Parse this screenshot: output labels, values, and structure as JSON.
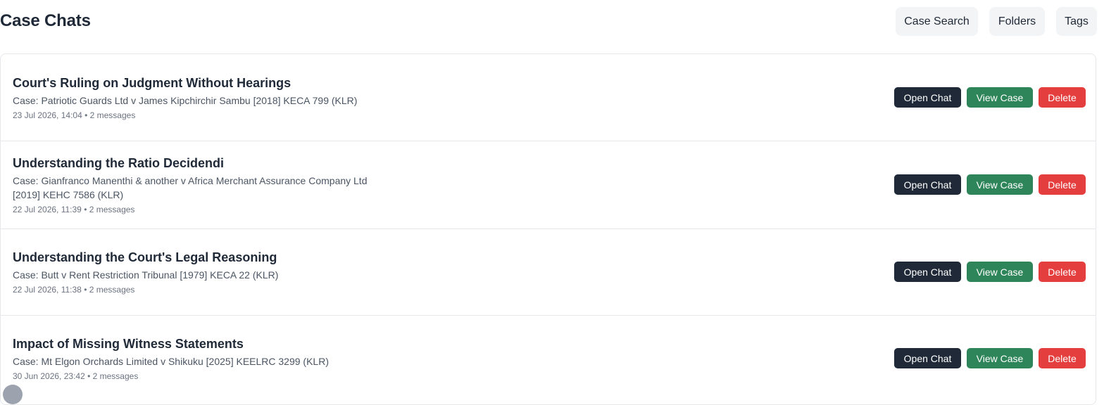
{
  "header": {
    "title": "Case Chats",
    "buttons": {
      "case_search": "Case Search",
      "folders": "Folders",
      "tags": "Tags"
    }
  },
  "actions": {
    "open_chat": "Open Chat",
    "view_case": "View Case",
    "delete": "Delete"
  },
  "colors": {
    "open_chat_bg": "#1f2937",
    "view_case_bg": "#2f855a",
    "delete_bg": "#e53e3e",
    "header_button_bg": "#f3f4f6"
  },
  "chats": [
    {
      "title": "Court's Ruling on Judgment Without Hearings",
      "case": "Case: Patriotic Guards Ltd v James Kipchirchir Sambu [2018] KECA 799 (KLR)",
      "meta": "23 Jul 2026, 14:04 • 2 messages"
    },
    {
      "title": "Understanding the Ratio Decidendi",
      "case": "Case: Gianfranco Manenthi & another v Africa Merchant Assurance Company Ltd [2019] KEHC 7586 (KLR)",
      "meta": "22 Jul 2026, 11:39 • 2 messages"
    },
    {
      "title": "Understanding the Court's Legal Reasoning",
      "case": "Case: Butt v Rent Restriction Tribunal [1979] KECA 22 (KLR)",
      "meta": "22 Jul 2026, 11:38 • 2 messages"
    },
    {
      "title": "Impact of Missing Witness Statements",
      "case": "Case: Mt Elgon Orchards Limited v Shikuku [2025] KEELRC 3299 (KLR)",
      "meta": "30 Jun 2026, 23:42 • 2 messages"
    }
  ]
}
